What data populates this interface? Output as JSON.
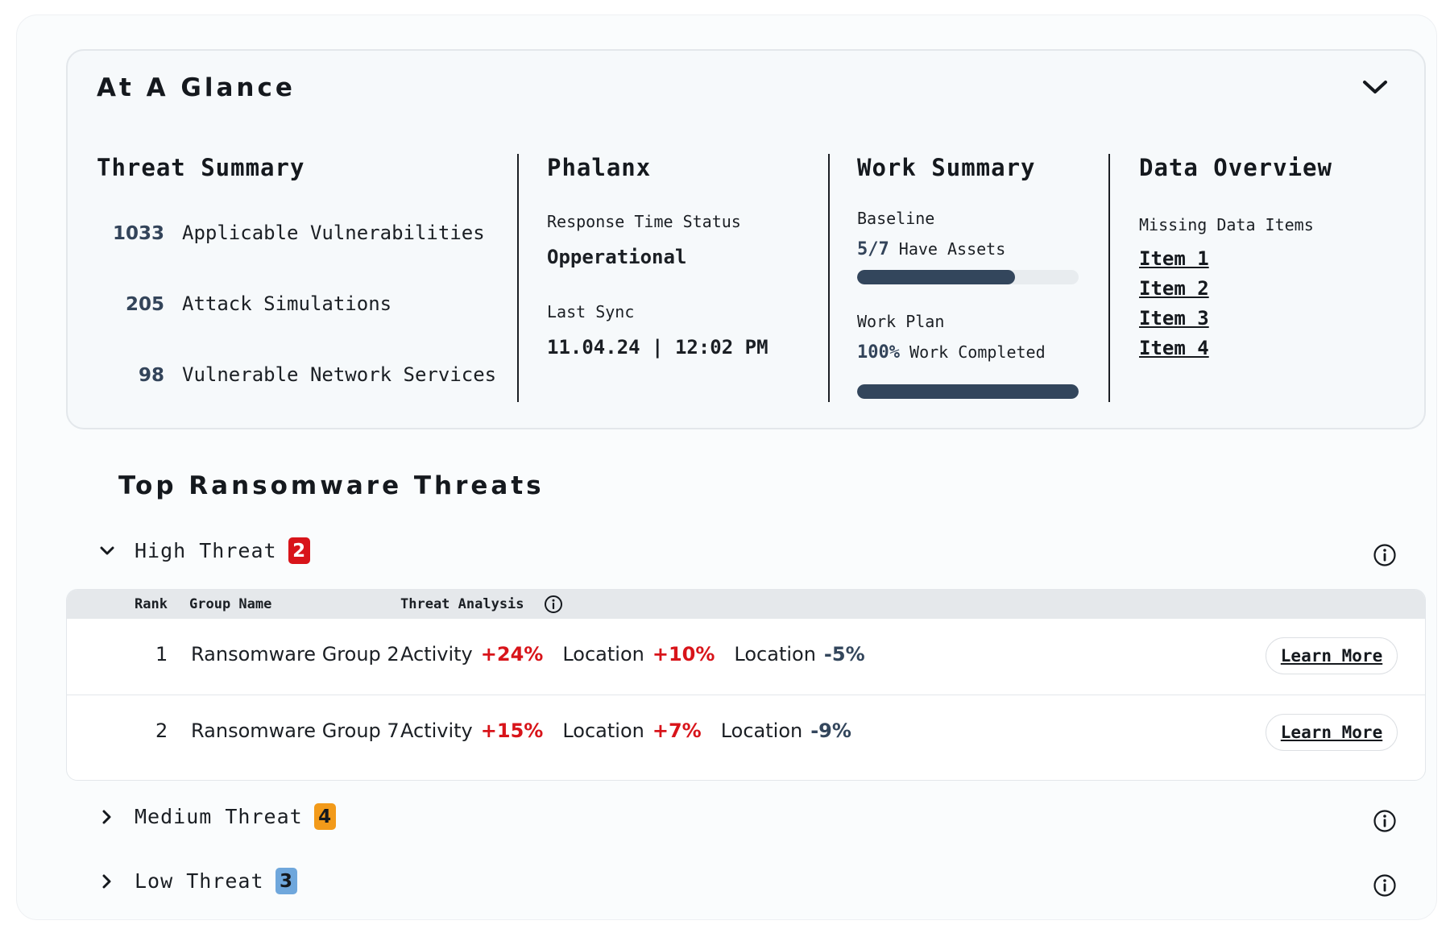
{
  "glance": {
    "title": "At A Glance",
    "threat_summary": {
      "title": "Threat Summary",
      "items": [
        {
          "count": "1033",
          "label": "Applicable Vulnerabilities"
        },
        {
          "count": "205",
          "label": "Attack Simulations"
        },
        {
          "count": "98",
          "label": "Vulnerable Network Services"
        }
      ]
    },
    "phalanx": {
      "title": "Phalanx",
      "status_label": "Response Time Status",
      "status_value": "Opperational",
      "sync_label": "Last Sync",
      "sync_value": "11.04.24 | 12:02 PM"
    },
    "work_summary": {
      "title": "Work Summary",
      "baseline_label": "Baseline",
      "baseline_value": "5/7",
      "baseline_text": "Have Assets",
      "baseline_progress": 0.714,
      "plan_label": "Work Plan",
      "plan_value": "100%",
      "plan_text": "Work Completed",
      "plan_progress": 1.0
    },
    "data_overview": {
      "title": "Data Overview",
      "missing_label": "Missing Data Items",
      "items": [
        "Item 1",
        "Item 2",
        "Item 3",
        "Item 4"
      ]
    }
  },
  "ransomware": {
    "title": "Top Ransomware Threats",
    "high": {
      "label": "High Threat",
      "count": "2",
      "color": "#d8141a"
    },
    "medium": {
      "label": "Medium Threat",
      "count": "4",
      "color": "#f29a1a"
    },
    "low": {
      "label": "Low Threat",
      "count": "3",
      "color": "#6fa7dc"
    },
    "columns": {
      "rank": "Rank",
      "group": "Group Name",
      "analysis": "Threat Analysis"
    },
    "rows": [
      {
        "rank": "1",
        "group": "Ransomware Group 2",
        "m1_label": "Activity",
        "m1_val": "+24%",
        "m2_label": "Location",
        "m2_val": "+10%",
        "m3_label": "Location",
        "m3_val": "-5%",
        "action": "Learn More"
      },
      {
        "rank": "2",
        "group": "Ransomware Group 7",
        "m1_label": "Activity",
        "m1_val": "+15%",
        "m2_label": "Location",
        "m2_val": "+7%",
        "m3_label": "Location",
        "m3_val": "-9%",
        "action": "Learn More"
      }
    ]
  }
}
